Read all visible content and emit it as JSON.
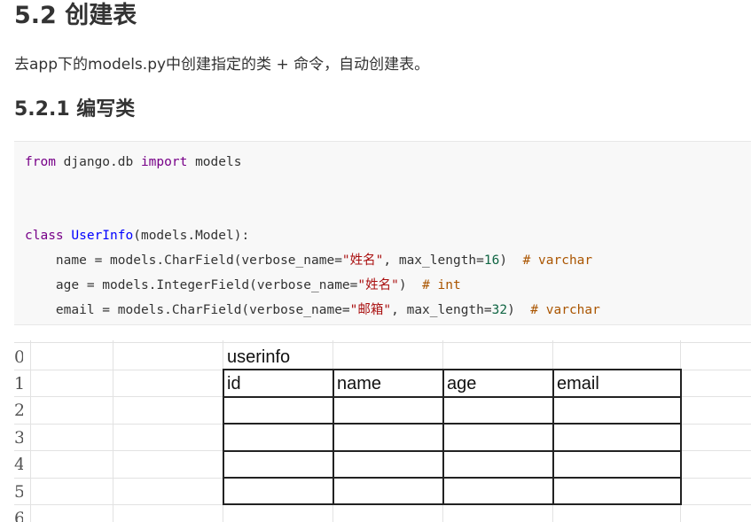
{
  "heading_main": "5.2 创建表",
  "paragraph": "去app下的models.py中创建指定的类 + 命令，自动创建表。",
  "heading_sub": "5.2.1 编写类",
  "code": {
    "l1_from": "from",
    "l1_mod": " django.db ",
    "l1_import": "import",
    "l1_name": " models",
    "l2_class": "class",
    "l2_classname": "UserInfo",
    "l2_rest": "(models.Model):",
    "l3_a": "    name = models.CharField(verbose_name=",
    "l3_str": "\"姓名\"",
    "l3_b": ", max_length=",
    "l3_num": "16",
    "l3_c": ")  ",
    "l3_cmt": "# varchar",
    "l4_a": "    age = models.IntegerField(verbose_name=",
    "l4_str": "\"姓名\"",
    "l4_c": ")  ",
    "l4_cmt": "# int",
    "l5_a": "    email = models.CharField(verbose_name=",
    "l5_str": "\"邮箱\"",
    "l5_b": ", max_length=",
    "l5_num": "32",
    "l5_c": ")  ",
    "l5_cmt": "# varchar"
  },
  "sheet": {
    "row_numbers": [
      "0",
      "1",
      "2",
      "3",
      "4",
      "5",
      "6"
    ],
    "table_title": "userinfo",
    "columns": [
      "id",
      "name",
      "age",
      "email"
    ]
  }
}
